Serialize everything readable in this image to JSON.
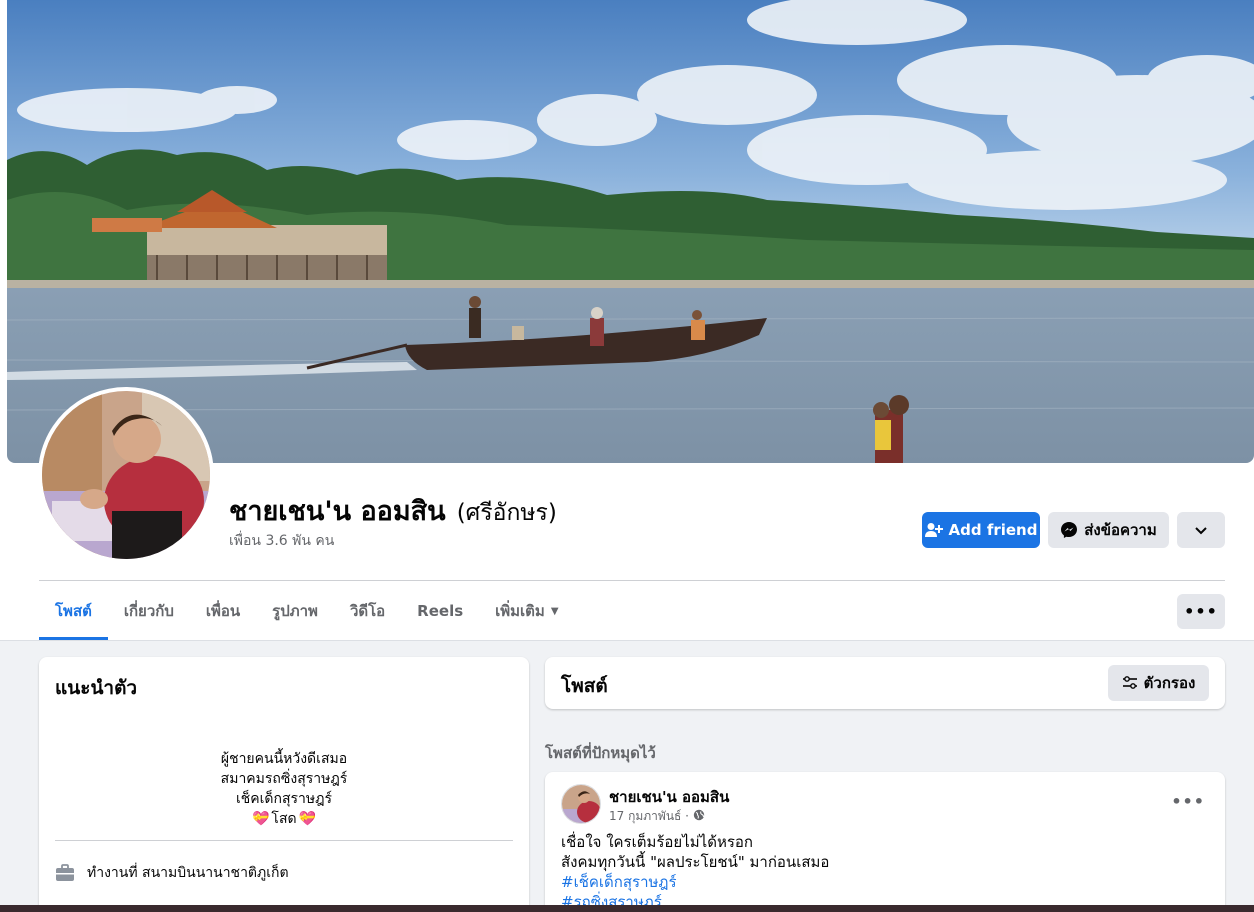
{
  "profile": {
    "name": "ชายเชน'น ออมสิน",
    "alt_name": "(ศรีอักษร)",
    "friends": "เพื่อน 3.6 พัน คน"
  },
  "actions": {
    "add_friend": "Add friend",
    "message": "ส่งข้อความ"
  },
  "tabs": [
    {
      "label": "โพสต์",
      "active": true
    },
    {
      "label": "เกี่ยวกับ"
    },
    {
      "label": "เพื่อน"
    },
    {
      "label": "รูปภาพ"
    },
    {
      "label": "วิดีโอ"
    },
    {
      "label": "Reels"
    },
    {
      "label": "เพิ่มเติม"
    }
  ],
  "intro": {
    "title": "แนะนำตัว",
    "bio": [
      "ผู้ชายคนนี้หวังดีเสมอ",
      "สมาคมรถซิ่งสุราษฎร์",
      "เช็คเด็กสุราษฎร์",
      "โสด"
    ],
    "work": "ทำงานที่ สนามบินนานาชาติภูเก็ต"
  },
  "posts": {
    "title": "โพสต์",
    "filter": "ตัวกรอง",
    "pinned_label": "โพสต์ที่ปักหมุดไว้",
    "pinned": {
      "author": "ชายเชน'น ออมสิน",
      "date": "17 กุมภาพันธ์ ·",
      "lines": [
        "เชื่อใจ ใครเต็มร้อยไม่ได้หรอก",
        "สังคมทุกวันนี้ \"ผลประโยชน์\" มาก่อนเสมอ"
      ],
      "hashtags": [
        "#เช็คเด็กสุราษฎร์",
        "#รถซิ่งสุราษฎร์"
      ]
    }
  },
  "colors": {
    "accent": "#1b74e4",
    "secondary_btn": "#e4e6eb",
    "page_bg": "#f0f2f5",
    "muted_text": "#65676b"
  },
  "icons": [
    "add-friend-icon",
    "messenger-icon",
    "chevron-down-icon",
    "more-dots-icon",
    "filter-icon",
    "briefcase-icon",
    "globe-icon",
    "heart-emoji-icon"
  ]
}
